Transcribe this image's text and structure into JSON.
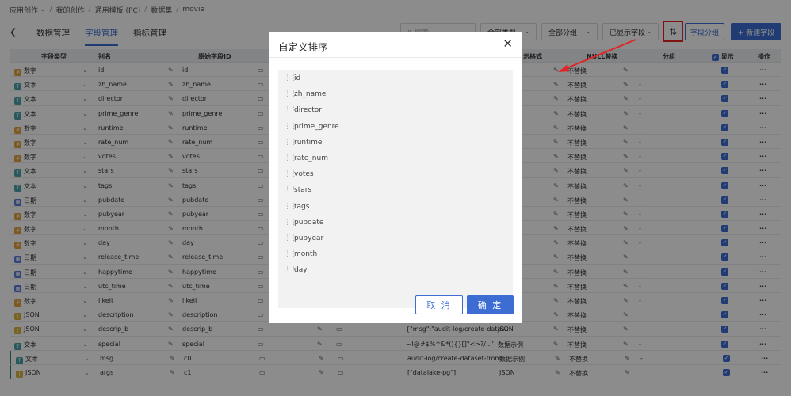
{
  "breadcrumb": {
    "items": [
      "应用创作",
      "我的创作",
      "通用模板 (PC)",
      "数据集",
      "movie"
    ]
  },
  "toolbar": {
    "back_icon": "arrow-left",
    "tabs": [
      "数据管理",
      "字段管理",
      "指标管理"
    ],
    "search_placeholder": "搜索",
    "category_filter": "全部类型",
    "group_filter": "全部分组",
    "show_filter": "已显示字段",
    "field_group_button": "字段分组",
    "new_field_button": "+ 新建字段"
  },
  "table": {
    "headers": {
      "type": "字段类型",
      "alias": "别名",
      "orig_id": "原始字段ID",
      "display_format": "示格式",
      "null_replace": "NULL替换",
      "group": "分组",
      "show": "显示",
      "action": "操作"
    },
    "rows": [
      {
        "type": "数字",
        "alias": "id",
        "orig": "id",
        "sample": "",
        "fmt": "",
        "nul": "不替换",
        "grp": "-"
      },
      {
        "type": "文本",
        "alias": "zh_name",
        "orig": "zh_name",
        "sample": "",
        "fmt": "",
        "nul": "不替换",
        "grp": "-"
      },
      {
        "type": "文本",
        "alias": "director",
        "orig": "director",
        "sample": "",
        "fmt": "",
        "nul": "不替换",
        "grp": "-"
      },
      {
        "type": "文本",
        "alias": "prime_genre",
        "orig": "prime_genre",
        "sample": "",
        "fmt": "",
        "nul": "不替换",
        "grp": "-"
      },
      {
        "type": "数字",
        "alias": "runtime",
        "orig": "runtime",
        "sample": "",
        "fmt": "",
        "nul": "不替换",
        "grp": "-"
      },
      {
        "type": "数字",
        "alias": "rate_num",
        "orig": "rate_num",
        "sample": "",
        "fmt": "",
        "nul": "不替换",
        "grp": "-"
      },
      {
        "type": "数字",
        "alias": "votes",
        "orig": "votes",
        "sample": "",
        "fmt": "",
        "nul": "不替换",
        "grp": "-"
      },
      {
        "type": "文本",
        "alias": "stars",
        "orig": "stars",
        "sample": "",
        "fmt": "",
        "nul": "不替换",
        "grp": "-"
      },
      {
        "type": "文本",
        "alias": "tags",
        "orig": "tags",
        "sample": "",
        "fmt": "",
        "nul": "不替换",
        "grp": "-"
      },
      {
        "type": "日期",
        "alias": "pubdate",
        "orig": "pubdate",
        "sample": "",
        "fmt": "",
        "nul": "不替换",
        "grp": "-"
      },
      {
        "type": "数字",
        "alias": "pubyear",
        "orig": "pubyear",
        "sample": "",
        "fmt": "",
        "nul": "不替换",
        "grp": "-"
      },
      {
        "type": "数字",
        "alias": "month",
        "orig": "month",
        "sample": "",
        "fmt": "",
        "nul": "不替换",
        "grp": "-"
      },
      {
        "type": "数字",
        "alias": "day",
        "orig": "day",
        "sample": "",
        "fmt": "",
        "nul": "不替换",
        "grp": "-"
      },
      {
        "type": "日期",
        "alias": "release_time",
        "orig": "release_time",
        "sample": "",
        "fmt": "",
        "nul": "不替换",
        "grp": "-"
      },
      {
        "type": "日期",
        "alias": "happytime",
        "orig": "happytime",
        "sample": "",
        "fmt": "",
        "nul": "不替换",
        "grp": "-"
      },
      {
        "type": "日期",
        "alias": "utc_time",
        "orig": "utc_time",
        "sample": "",
        "fmt": "",
        "nul": "不替换",
        "grp": "-"
      },
      {
        "type": "数字",
        "alias": "likeit",
        "orig": "likeit",
        "sample": "",
        "fmt": "",
        "nul": "不替换",
        "grp": "-"
      },
      {
        "type": "JSON",
        "alias": "description",
        "orig": "description",
        "sample": "",
        "fmt": "",
        "nul": "不替换",
        "grp": ""
      },
      {
        "type": "JSON",
        "alias": "descrip_b",
        "orig": "descrip_b",
        "sample": "{\"msg\":\"audit-log/create-datas...",
        "fmt": "JSON",
        "nul": "不替换",
        "grp": ""
      },
      {
        "type": "文本",
        "alias": "special",
        "orig": "special",
        "sample": "~!@#$%^&*(){}[]\"<>?/...'",
        "fmt": "数据示例",
        "nul": "不替换",
        "grp": "-"
      },
      {
        "type": "文本",
        "alias": "msg",
        "orig": "c0",
        "sample": "audit-log/create-dataset-from-...",
        "fmt": "数据示例",
        "nul": "不替换",
        "grp": "-"
      },
      {
        "type": "JSON",
        "alias": "args",
        "orig": "c1",
        "sample": "[\"datalake-pg\"]",
        "fmt": "JSON",
        "nul": "不替换",
        "grp": ""
      }
    ]
  },
  "dialog": {
    "title": "自定义排序",
    "items": [
      "id",
      "zh_name",
      "director",
      "prime_genre",
      "runtime",
      "rate_num",
      "votes",
      "stars",
      "tags",
      "pubdate",
      "pubyear",
      "month",
      "day"
    ],
    "cancel": "取 消",
    "ok": "确 定"
  },
  "colors": {
    "accent": "#3d6dd3",
    "highlight": "#e32424"
  }
}
